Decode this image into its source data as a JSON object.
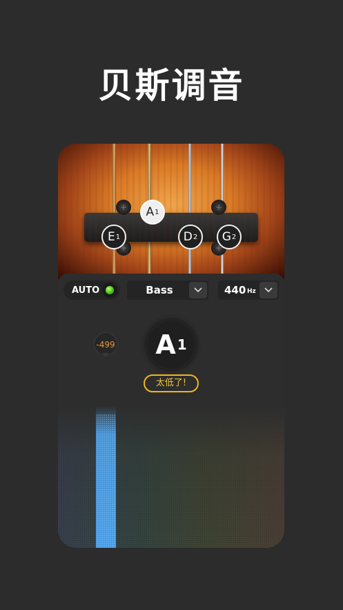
{
  "headline": "贝斯调音",
  "strings": [
    {
      "note": "E",
      "octave": "1",
      "active": false
    },
    {
      "note": "A",
      "octave": "1",
      "active": true
    },
    {
      "note": "D",
      "octave": "2",
      "active": false
    },
    {
      "note": "G",
      "octave": "2",
      "active": false
    }
  ],
  "controls": {
    "auto_label": "AUTO",
    "auto_on": true,
    "instrument": "Bass",
    "frequency": "440",
    "frequency_unit": "Hz"
  },
  "tuner": {
    "cents_offset": "-499",
    "note": "A",
    "octave": "1",
    "status": "太低了!"
  },
  "colors": {
    "accent_status": "#f2b620",
    "cents_text": "#e89a3a",
    "led_green": "#3fbf1a",
    "spectrum_active": "#4aa8ff"
  }
}
